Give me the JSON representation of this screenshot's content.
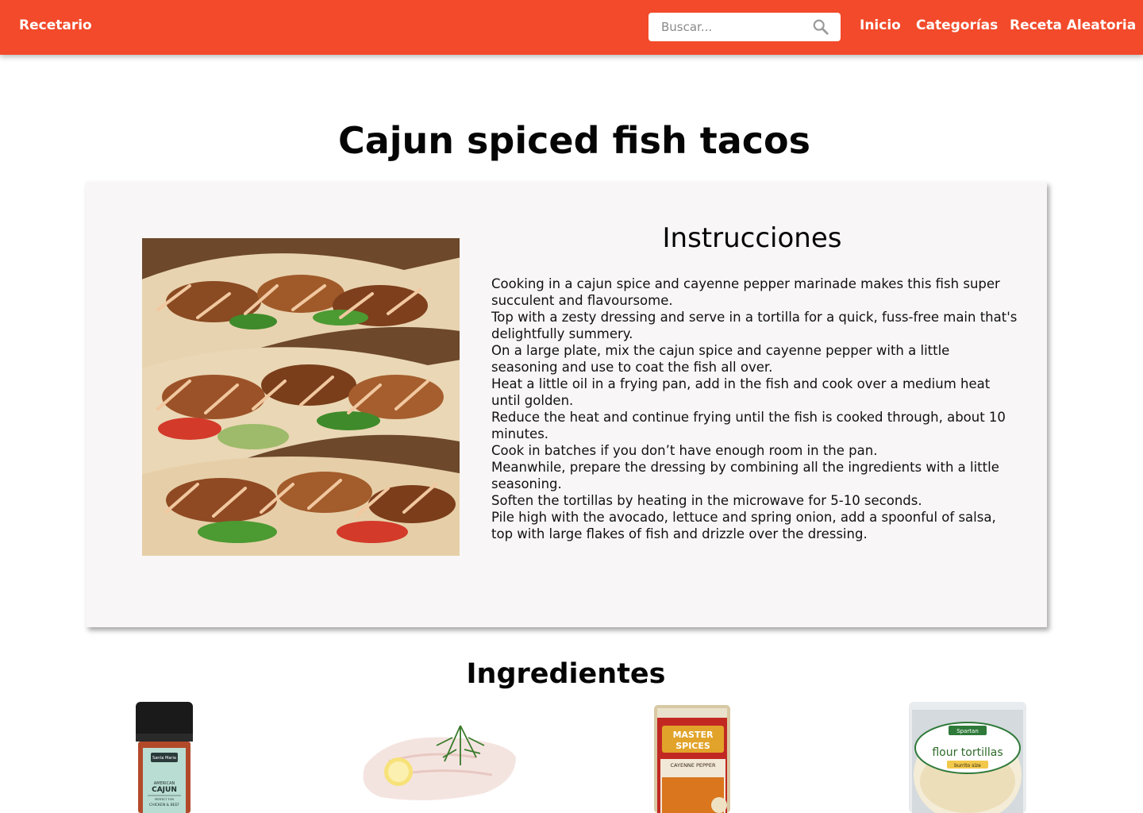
{
  "nav": {
    "brand": "Recetario",
    "search_placeholder": "Buscar...",
    "links": [
      "Inicio",
      "Categorías",
      "Receta Aleatoria"
    ]
  },
  "recipe": {
    "title": "Cajun spiced fish tacos",
    "instructions_heading": "Instrucciones",
    "instructions": [
      "Cooking in a cajun spice and cayenne pepper marinade makes this fish super succulent and flavoursome.",
      "Top with a zesty dressing and serve in a tortilla for a quick, fuss-free main that's delightfully summery.",
      "On a large plate, mix the cajun spice and cayenne pepper with a little seasoning and use to coat the fish all over.",
      "Heat a little oil in a frying pan, add in the fish and cook over a medium heat until golden.",
      "Reduce the heat and continue frying until the fish is cooked through, about 10 minutes.",
      "Cook in batches if you don’t have enough room in the pan.",
      "Meanwhile, prepare the dressing by combining all the ingredients with a little seasoning.",
      "Soften the tortillas by heating in the microwave for 5-10 seconds.",
      "Pile high with the avocado, lettuce and spring onion, add a spoonful of salsa, top with large flakes of fish and drizzle over the dressing."
    ]
  },
  "ingredients_heading": "Ingredientes",
  "ingredient_labels": {
    "cajun": {
      "brand": "Santa Maria",
      "line1": "AMERICAN",
      "line2": "CAJUN",
      "line3": "PERFECT FOR",
      "line4": "CHICKEN & BEEF"
    },
    "cayenne": {
      "brand1": "MASTER",
      "brand2": "SPICES",
      "name": "CAYENNE PEPPER"
    },
    "tortillas": {
      "brand": "Spartan",
      "name": "flour tortillas",
      "size": "burrito size"
    }
  },
  "colors": {
    "navbar": "#f24a2a",
    "card_bg": "#f8f6f6"
  }
}
